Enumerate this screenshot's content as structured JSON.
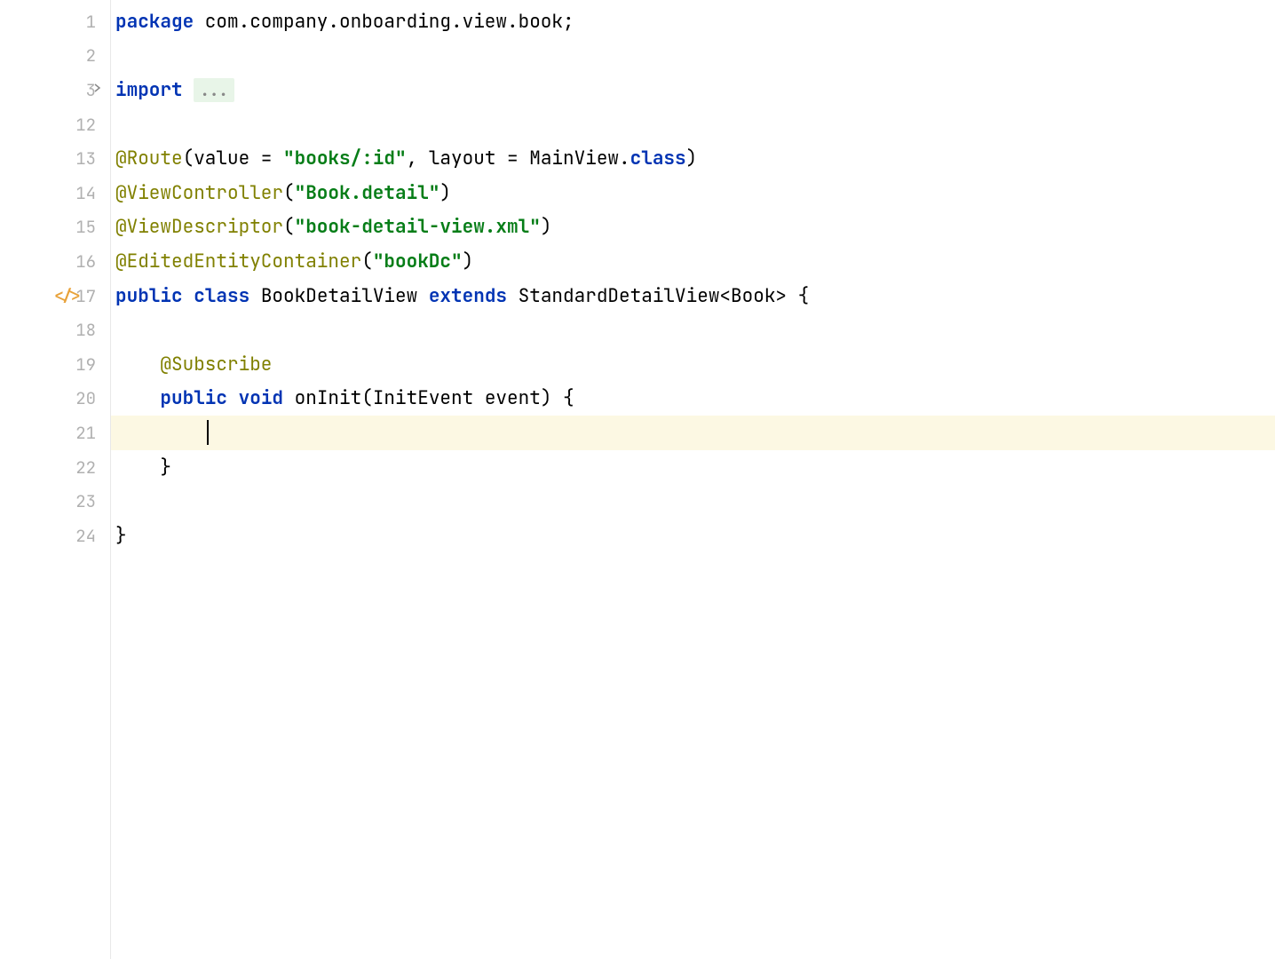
{
  "gutter": {
    "lines": [
      "1",
      "2",
      "3",
      "12",
      "13",
      "14",
      "15",
      "16",
      "17",
      "18",
      "19",
      "20",
      "21",
      "22",
      "23",
      "24"
    ]
  },
  "code": {
    "line1_kw": "package",
    "line1_pkg": " com.company.onboarding.view.book;",
    "line3_kw": "import",
    "line3_fold": "...",
    "line13_anno": "@Route",
    "line13_p1": "(value = ",
    "line13_str1": "\"books/:id\"",
    "line13_p2": ", layout = MainView.",
    "line13_kw2": "class",
    "line13_p3": ")",
    "line14_anno": "@ViewController",
    "line14_p1": "(",
    "line14_str": "\"Book.detail\"",
    "line14_p2": ")",
    "line15_anno": "@ViewDescriptor",
    "line15_p1": "(",
    "line15_str": "\"book-detail-view.xml\"",
    "line15_p2": ")",
    "line16_anno": "@EditedEntityContainer",
    "line16_p1": "(",
    "line16_str": "\"bookDc\"",
    "line16_p2": ")",
    "line17_kw1": "public",
    "line17_kw2": " class",
    "line17_name": " BookDetailView ",
    "line17_kw3": "extends",
    "line17_ext": " StandardDetailView<Book> {",
    "line19_anno": "@Subscribe",
    "line20_kw1": "public",
    "line20_kw2": " void",
    "line20_method": " onInit(InitEvent event) {",
    "line22": "}",
    "line24": "}"
  },
  "indent1": "    ",
  "indent2": "        "
}
